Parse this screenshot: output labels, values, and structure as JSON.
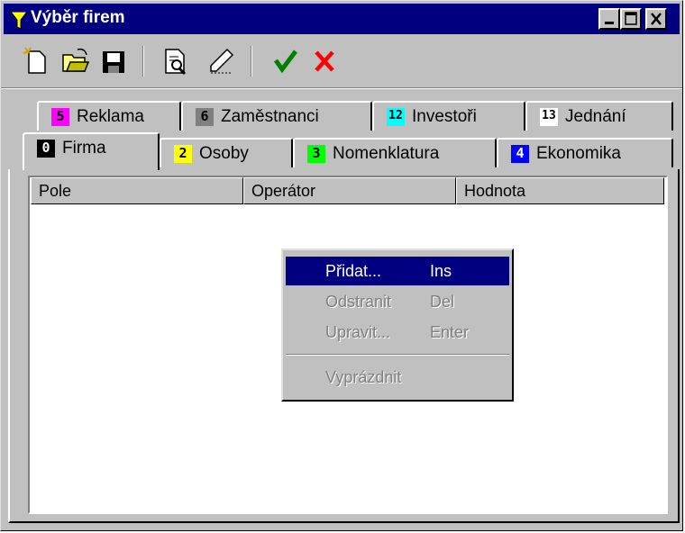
{
  "window": {
    "title": "Výběr firem"
  },
  "title_icons": {
    "app": "filter-funnel-icon",
    "minimize": "minimize-icon",
    "maximize": "maximize-icon",
    "close": "close-icon"
  },
  "toolbar": {
    "buttons": [
      {
        "name": "new-icon"
      },
      {
        "name": "open-folder-icon"
      },
      {
        "name": "save-icon"
      },
      {
        "name": "preview-icon"
      },
      {
        "name": "edit-pen-icon"
      },
      {
        "name": "ok-checkmark-icon",
        "color": "#008000"
      },
      {
        "name": "cancel-x-icon",
        "color": "#ff0000"
      }
    ]
  },
  "tabs": {
    "back_row": [
      {
        "num": "5",
        "label": "Reklama",
        "badge_color": "#ff00ff",
        "num_color": "#000000"
      },
      {
        "num": "6",
        "label": "Zaměstnanci",
        "badge_color": "#808080",
        "num_color": "#000000"
      },
      {
        "num": "12",
        "label": "Investoři",
        "badge_color": "#00ffff",
        "num_color": "#000000"
      },
      {
        "num": "13",
        "label": "Jednání",
        "badge_color": "#ffffff",
        "num_color": "#000000"
      }
    ],
    "front_row": [
      {
        "num": "0",
        "label": "Firma",
        "badge_color": "#000000",
        "num_color": "#ffffff"
      },
      {
        "num": "2",
        "label": "Osoby",
        "badge_color": "#ffff00",
        "num_color": "#000000"
      },
      {
        "num": "3",
        "label": "Nomenklatura",
        "badge_color": "#00ff00",
        "num_color": "#000000"
      },
      {
        "num": "4",
        "label": "Ekonomika",
        "badge_color": "#0000ff",
        "num_color": "#ffffff"
      }
    ],
    "active": "Firma"
  },
  "listview": {
    "columns": [
      "Pole",
      "Operátor",
      "Hodnota"
    ]
  },
  "context_menu": {
    "items": [
      {
        "label": "Přidat...",
        "shortcut": "Ins",
        "state": "selected"
      },
      {
        "label": "Odstranit",
        "shortcut": "Del",
        "state": "disabled"
      },
      {
        "label": "Upravit...",
        "shortcut": "Enter",
        "state": "disabled"
      },
      {
        "label": "Vyprázdnit",
        "shortcut": "",
        "state": "disabled"
      }
    ]
  }
}
